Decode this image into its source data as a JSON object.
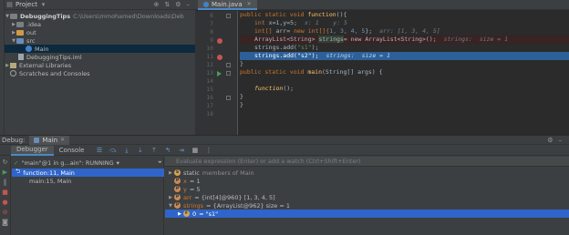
{
  "project": {
    "title": "Project",
    "tree": [
      {
        "label": "DebuggingTips",
        "path": "C:\\Users\\mmohamed\\Downloads\\Deb",
        "bold": true
      },
      {
        "label": ".idea"
      },
      {
        "label": "out"
      },
      {
        "label": "src"
      },
      {
        "label": "Main"
      },
      {
        "label": "DebuggingTips.iml"
      },
      {
        "label": "External Libraries"
      },
      {
        "label": "Scratches and Consoles"
      }
    ]
  },
  "editor": {
    "tab_label": "Main.java",
    "line_numbers": [
      "6",
      "7",
      "8",
      "9",
      "10",
      "11",
      "12",
      "13",
      "14",
      "15",
      "16",
      "17",
      "18"
    ],
    "lines": {
      "l6": {
        "a": "public static void ",
        "b": "function",
        "c": "(){"
      },
      "l7": {
        "a": "int ",
        "b": "x=1,y=5;",
        "hint": "x: 1    y: 5"
      },
      "l8": {
        "a": "int[] ",
        "b": "arr= ",
        "c": "new int[]{",
        "n": "1, 3, 4, 5",
        "d": "};",
        "hint": "arr: [1, 3, 4, 5]"
      },
      "l9": {
        "a": "ArrayList<String> ",
        "b": "strings",
        "c": "= new ArrayList<String>();",
        "hint": "strings:  size = 1"
      },
      "l10": {
        "a": "strings.add(",
        "s": "\"s1\"",
        "b": ");"
      },
      "l11": {
        "a": "strings.add(",
        "s": "\"s2\"",
        "b": ");",
        "hint": "strings:  size = 1"
      },
      "l12": {
        "a": "}"
      },
      "l13": {
        "a": "public static void ",
        "b": "main",
        "c": "(String[] args) {"
      },
      "l15": {
        "a": "function",
        "b": "();"
      },
      "l16": {
        "a": "}"
      },
      "l17": {
        "a": "}"
      }
    }
  },
  "debug": {
    "label": "Debug:",
    "tab_label": "Main",
    "tabs": {
      "debugger": "Debugger",
      "console": "Console"
    },
    "thread": "\"main\"@1 in g...ain\": RUNNING",
    "frames": [
      "function:11, Main",
      "main:15, Main"
    ],
    "eval_placeholder": "Evaluate expression (Enter) or add a watch (Ctrl+Shift+Enter)",
    "variables": [
      {
        "badge": "S",
        "name": "static",
        "value": "members of Main"
      },
      {
        "badge": "P",
        "name": "x",
        "value": "= 1"
      },
      {
        "badge": "P",
        "name": "y",
        "value": "= 5"
      },
      {
        "badge": "P",
        "name": "arr",
        "value": "= {int[4]@960} [1, 3, 4, 5]"
      },
      {
        "badge": "P",
        "name": "strings",
        "value": "= {ArrayList@962}  size = 1"
      },
      {
        "badge": "F",
        "name": "0",
        "value": "= \"s1\""
      }
    ]
  }
}
